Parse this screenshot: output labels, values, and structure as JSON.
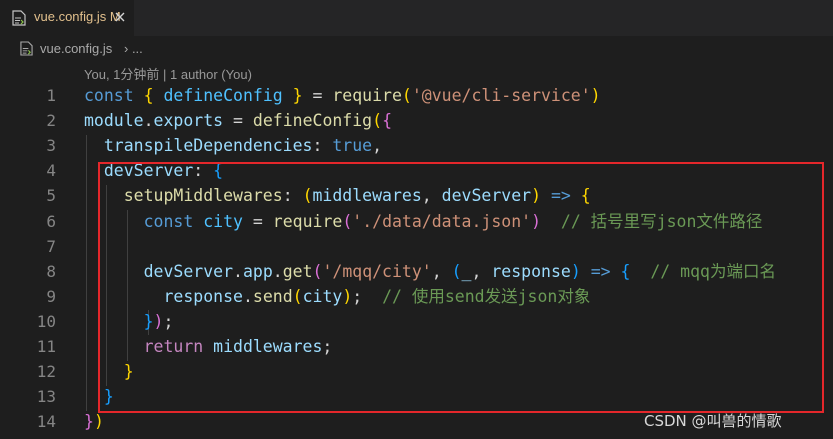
{
  "tab": {
    "filename": "vue.config.js",
    "status": "M"
  },
  "breadcrumb": {
    "file": "vue.config.js",
    "separator": "› ..."
  },
  "codelens": "You, 1分钟前 | 1 author (You)",
  "watermark": "CSDN @叫兽的情歌",
  "icons": {
    "tab_file": "js-file-icon",
    "tab_close": "close-icon",
    "crumb_file": "js-file-icon"
  },
  "colors": {
    "highlight_border": "#e5272b",
    "modified": "#e2c08d",
    "keyword": "#569cd6",
    "string": "#ce9178",
    "comment": "#6a9955"
  },
  "lines": [
    {
      "n": "1",
      "tokens": [
        [
          "const ",
          "k-blue"
        ],
        [
          "{ ",
          "p1"
        ],
        [
          "defineConfig ",
          "cn"
        ],
        [
          "}",
          "p1"
        ],
        [
          " = ",
          "pl"
        ],
        [
          "require",
          "fn"
        ],
        [
          "(",
          "p1"
        ],
        [
          "'@vue/cli-service'",
          "str"
        ],
        [
          ")",
          "p1"
        ]
      ]
    },
    {
      "n": "2",
      "tokens": [
        [
          "module",
          "v"
        ],
        [
          ".",
          "pl"
        ],
        [
          "exports",
          "v"
        ],
        [
          " = ",
          "pl"
        ],
        [
          "defineConfig",
          "fn"
        ],
        [
          "(",
          "p1"
        ],
        [
          "{",
          "p2"
        ]
      ]
    },
    {
      "n": "3",
      "tokens": [
        [
          "  transpileDependencies",
          "v"
        ],
        [
          ": ",
          "pl"
        ],
        [
          "true",
          "k-blue"
        ],
        [
          ",",
          "pl"
        ]
      ]
    },
    {
      "n": "4",
      "tokens": [
        [
          "  devServer",
          "v"
        ],
        [
          ": ",
          "pl"
        ],
        [
          "{",
          "p3"
        ]
      ]
    },
    {
      "n": "5",
      "tokens": [
        [
          "    setupMiddlewares",
          "fn"
        ],
        [
          ": ",
          "pl"
        ],
        [
          "(",
          "p1"
        ],
        [
          "middlewares",
          "v"
        ],
        [
          ", ",
          "pl"
        ],
        [
          "devServer",
          "v"
        ],
        [
          ") ",
          "p1"
        ],
        [
          "=> ",
          "k-blue"
        ],
        [
          "{",
          "p1"
        ]
      ]
    },
    {
      "n": "6",
      "tokens": [
        [
          "      const ",
          "k-blue"
        ],
        [
          "city",
          "cn"
        ],
        [
          " = ",
          "pl"
        ],
        [
          "require",
          "fn"
        ],
        [
          "(",
          "p2"
        ],
        [
          "'./data/data.json'",
          "str"
        ],
        [
          ")",
          "p2"
        ],
        [
          "  // 括号里写json文件路径",
          "cm"
        ]
      ]
    },
    {
      "n": "7",
      "tokens": []
    },
    {
      "n": "8",
      "tokens": [
        [
          "      devServer",
          "v"
        ],
        [
          ".",
          "pl"
        ],
        [
          "app",
          "v"
        ],
        [
          ".",
          "pl"
        ],
        [
          "get",
          "fn"
        ],
        [
          "(",
          "p2"
        ],
        [
          "'/mqq/city'",
          "str"
        ],
        [
          ", ",
          "pl"
        ],
        [
          "(",
          "p3"
        ],
        [
          "_",
          "v"
        ],
        [
          ", ",
          "pl"
        ],
        [
          "response",
          "v"
        ],
        [
          ") ",
          "p3"
        ],
        [
          "=> ",
          "k-blue"
        ],
        [
          "{",
          "p3"
        ],
        [
          "  // mqq为端口名",
          "cm"
        ]
      ]
    },
    {
      "n": "9",
      "tokens": [
        [
          "        response",
          "v"
        ],
        [
          ".",
          "pl"
        ],
        [
          "send",
          "fn"
        ],
        [
          "(",
          "p1"
        ],
        [
          "city",
          "v"
        ],
        [
          ")",
          "p1"
        ],
        [
          ";",
          "pl"
        ],
        [
          "  // 使用send发送json对象",
          "cm"
        ]
      ]
    },
    {
      "n": "10",
      "tokens": [
        [
          "      }",
          "p3"
        ],
        [
          ")",
          "p2"
        ],
        [
          ";",
          "pl"
        ]
      ]
    },
    {
      "n": "11",
      "tokens": [
        [
          "      return ",
          "k-purple"
        ],
        [
          "middlewares",
          "v"
        ],
        [
          ";",
          "pl"
        ]
      ]
    },
    {
      "n": "12",
      "tokens": [
        [
          "    }",
          "p1"
        ]
      ]
    },
    {
      "n": "13",
      "tokens": [
        [
          "  }",
          "p3"
        ]
      ]
    },
    {
      "n": "14",
      "tokens": [
        [
          "}",
          "p2"
        ],
        [
          ")",
          "p1"
        ]
      ]
    }
  ]
}
